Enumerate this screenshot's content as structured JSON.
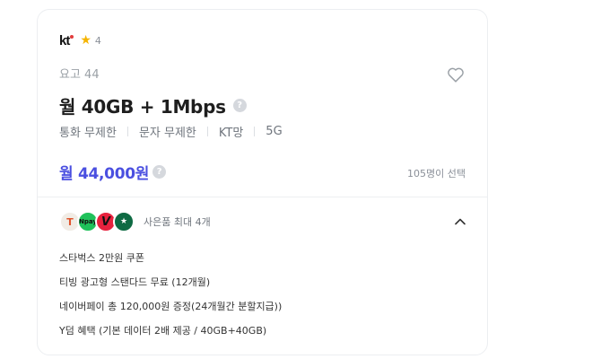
{
  "carrier": {
    "logo_text": "kt",
    "rating": "4",
    "star_icon": "star-icon"
  },
  "plan": {
    "name": "요고 44",
    "title": "월 40GB + 1Mbps",
    "features": [
      "통화 무제한",
      "문자 무제한",
      "KT망",
      "5G"
    ],
    "price": "월 44,000원",
    "selected_count": "105명이 선택"
  },
  "gifts": {
    "label": "사은품 최대 4개",
    "icons": [
      {
        "name": "tving-icon",
        "glyph": "T"
      },
      {
        "name": "naver-pay-icon",
        "glyph": "Npay"
      },
      {
        "name": "v-icon",
        "glyph": "V"
      },
      {
        "name": "starbucks-icon",
        "glyph": "★"
      }
    ],
    "items": [
      "스타벅스 2만원 쿠폰",
      "티빙 광고형 스탠다드 무료 (12개월)",
      "네이버페이 총 120,000원 증정(24개월간 분할지급))",
      "Y덤 혜택 (기본 데이터 2배 제공 / 40GB+40GB)"
    ]
  },
  "colors": {
    "price": "#4a4fe0",
    "star": "#f5b400"
  }
}
